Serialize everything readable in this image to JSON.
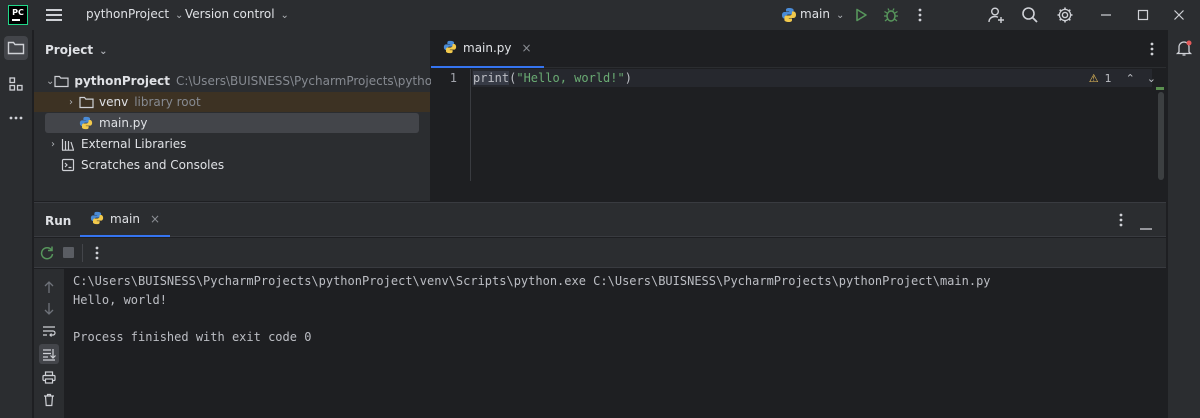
{
  "app": {
    "logo_text": "PC",
    "project_menu": "pythonProject",
    "vcs_menu": "Version control",
    "run_config": "main"
  },
  "project_panel": {
    "title": "Project",
    "tree": [
      {
        "name": "pythonProject",
        "detail": "C:\\Users\\BUISNESS\\PycharmProjects\\pythonProject"
      },
      {
        "name": "venv",
        "detail": "library root"
      },
      {
        "name": "main.py",
        "detail": ""
      },
      {
        "name": "External Libraries",
        "detail": ""
      },
      {
        "name": "Scratches and Consoles",
        "detail": ""
      }
    ]
  },
  "editor": {
    "tab_label": "main.py",
    "line_number": "1",
    "code": {
      "fn": "print",
      "open": "(",
      "str": "\"Hello, world!\"",
      "close": ")"
    },
    "warning_count": "1"
  },
  "run_panel": {
    "title": "Run",
    "tab_label": "main",
    "output": [
      "C:\\Users\\BUISNESS\\PycharmProjects\\pythonProject\\venv\\Scripts\\python.exe C:\\Users\\BUISNESS\\PycharmProjects\\pythonProject\\main.py",
      "Hello, world!",
      "",
      "Process finished with exit code 0"
    ]
  },
  "icons": {
    "folder": "folder-icon",
    "python": "python-file-icon",
    "run": "run-icon",
    "debug": "debug-icon"
  },
  "colors": {
    "accent": "#3574f0",
    "run_green": "#57965c",
    "string_green": "#6aab73",
    "warning": "#f2c55c"
  }
}
